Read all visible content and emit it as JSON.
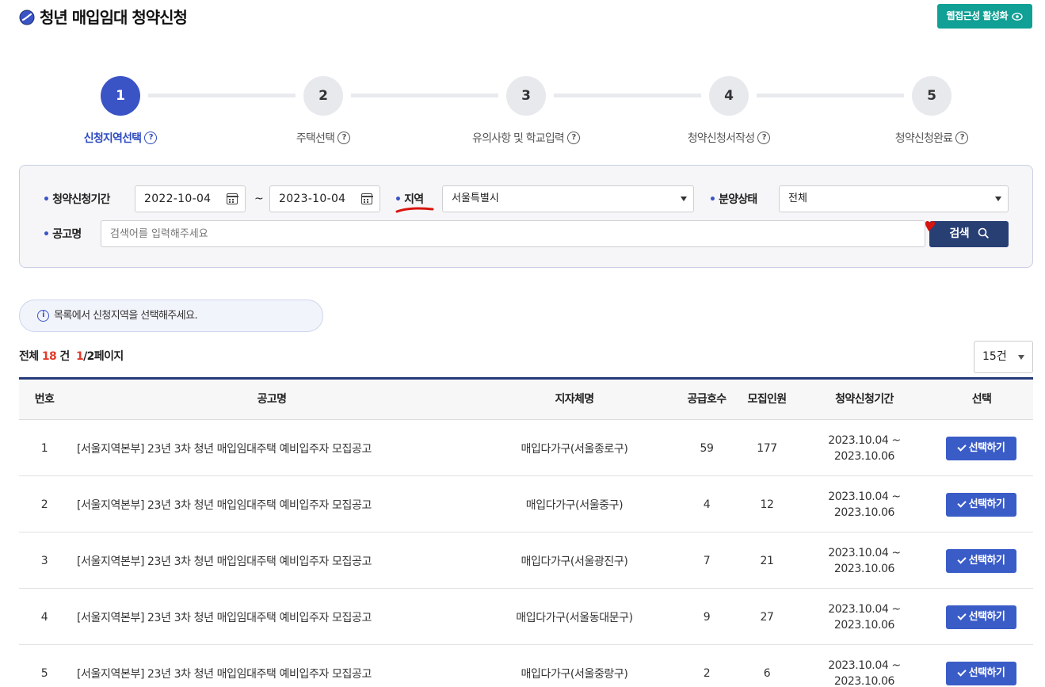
{
  "header": {
    "title": "청년 매입임대 청약신청",
    "access_button": "웹접근성 활성화"
  },
  "steps": [
    {
      "number": "1",
      "label": "신청지역선택",
      "active": true
    },
    {
      "number": "2",
      "label": "주택선택",
      "active": false
    },
    {
      "number": "3",
      "label": "유의사항 및 학교입력",
      "active": false
    },
    {
      "number": "4",
      "label": "청약신청서작성",
      "active": false
    },
    {
      "number": "5",
      "label": "청약신청완료",
      "active": false
    }
  ],
  "search": {
    "period_label": "청약신청기간",
    "date_from": "2022-10-04",
    "tilde": "~",
    "date_to": "2023-10-04",
    "region_label": "지역",
    "region_value": "서울특별시",
    "status_label": "분양상태",
    "status_value": "전체",
    "notice_name_label": "공고명",
    "notice_placeholder": "검색어를 입력해주세요",
    "search_button": "검색"
  },
  "notice": {
    "text": "목록에서 신청지역을 선택해주세요."
  },
  "summary": {
    "total_prefix": "전체",
    "total_count": "18",
    "count_unit": "건",
    "current_page": "1",
    "page_suffix": "/2페이지"
  },
  "page_size": {
    "value": "15건"
  },
  "table": {
    "headers": {
      "no": "번호",
      "title": "공고명",
      "branch": "지자체명",
      "supply": "공급호수",
      "recruit": "모집인원",
      "period": "청약신청기간",
      "select": "선택"
    },
    "rows": [
      {
        "no": "1",
        "title": "[서울지역본부] 23년 3차 청년 매입임대주택 예비입주자 모집공고",
        "branch": "매입다가구(서울종로구)",
        "supply": "59",
        "recruit": "177",
        "period_start": "2023.10.04 ~",
        "period_end": "2023.10.06",
        "button": "선택하기"
      },
      {
        "no": "2",
        "title": "[서울지역본부] 23년 3차 청년 매입임대주택 예비입주자 모집공고",
        "branch": "매입다가구(서울중구)",
        "supply": "4",
        "recruit": "12",
        "period_start": "2023.10.04 ~",
        "period_end": "2023.10.06",
        "button": "선택하기"
      },
      {
        "no": "3",
        "title": "[서울지역본부] 23년 3차 청년 매입임대주택 예비입주자 모집공고",
        "branch": "매입다가구(서울광진구)",
        "supply": "7",
        "recruit": "21",
        "period_start": "2023.10.04 ~",
        "period_end": "2023.10.06",
        "button": "선택하기"
      },
      {
        "no": "4",
        "title": "[서울지역본부] 23년 3차 청년 매입임대주택 예비입주자 모집공고",
        "branch": "매입다가구(서울동대문구)",
        "supply": "9",
        "recruit": "27",
        "period_start": "2023.10.04 ~",
        "period_end": "2023.10.06",
        "button": "선택하기"
      },
      {
        "no": "5",
        "title": "[서울지역본부] 23년 3차 청년 매입임대주택 예비입주자 모집공고",
        "branch": "매입다가구(서울중랑구)",
        "supply": "2",
        "recruit": "6",
        "period_start": "2023.10.04 ~",
        "period_end": "2023.10.06",
        "button": "선택하기"
      }
    ]
  },
  "colors": {
    "primary": "#3a54c6",
    "teal": "#11a095",
    "navy": "#283f74",
    "accent_red": "#e23b2c"
  }
}
